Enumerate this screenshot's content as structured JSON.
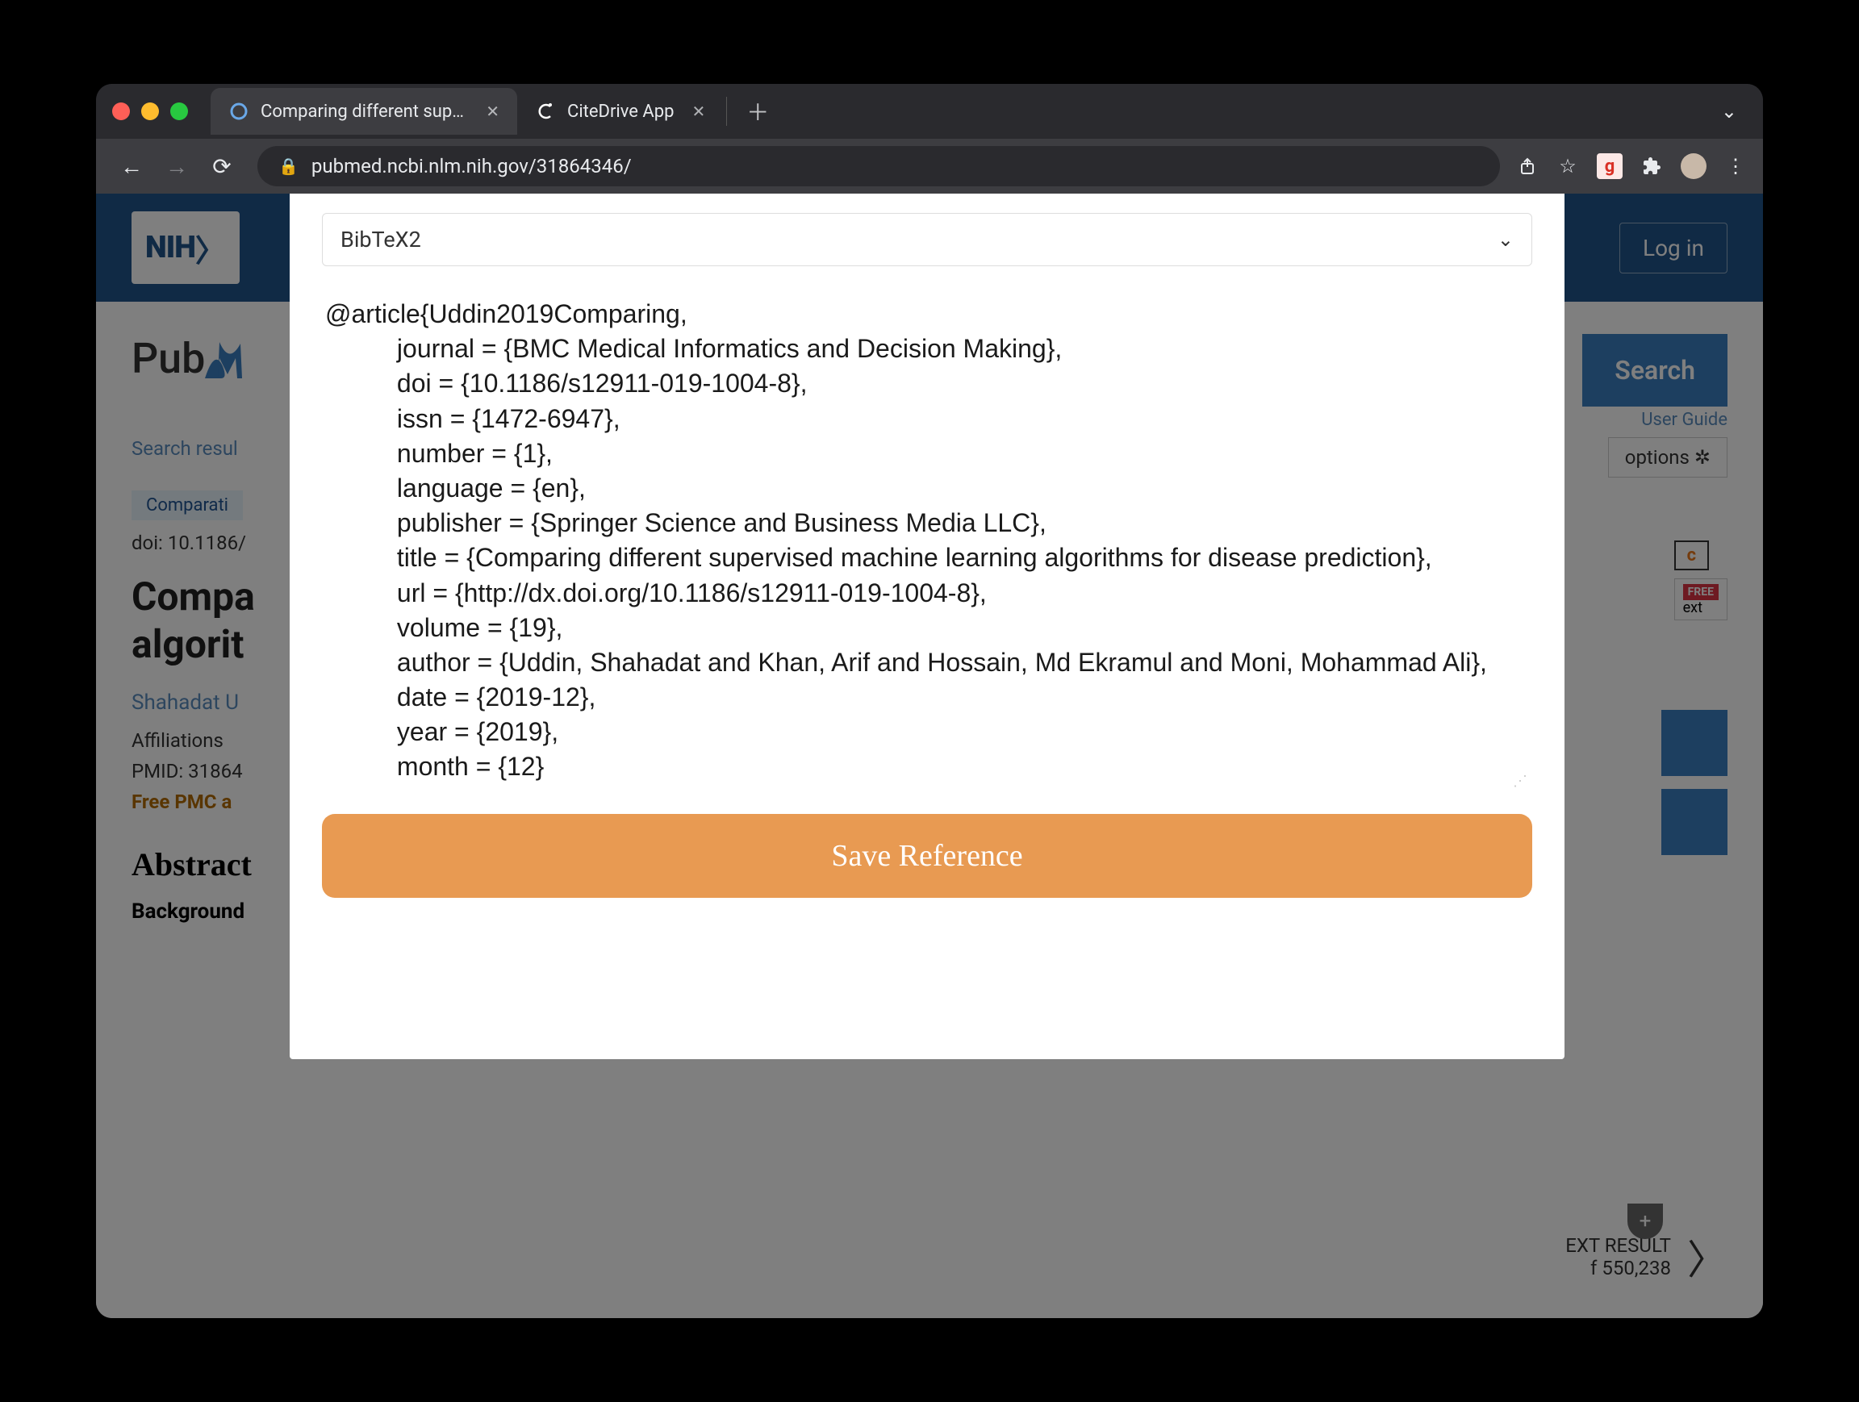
{
  "tabs": {
    "tab1": {
      "title": "Comparing different supervise"
    },
    "tab2": {
      "title": "CiteDrive App"
    }
  },
  "url_text": "pubmed.ncbi.nlm.nih.gov/31864346/",
  "nih": {
    "logo": "NIH",
    "login": "Log in"
  },
  "pubmed": {
    "brand_prefix": "Pub",
    "brand_m": "M",
    "search_btn": "Search",
    "user_guide": "User Guide"
  },
  "results": {
    "search_result": "Search resul",
    "display_options": "options",
    "gear_suffix": " ✲"
  },
  "article": {
    "comparative": "Comparati",
    "doi": "doi: 10.1186/",
    "title_visible": "Compa\nalgorit",
    "authors": "Shahadat U",
    "affiliations": "Affiliations  ",
    "pmid": "PMID: 31864",
    "free_pmc": "Free PMC a",
    "abstract": "Abstract",
    "background": "Background"
  },
  "fulltext": {
    "bmc_prefix": "c",
    "free_tag": "FREE",
    "ext_label": "ext"
  },
  "next_result": {
    "line1": "EXT RESULT",
    "line2": "f 550,238"
  },
  "modal": {
    "select_label": "BibTeX2",
    "bibtex": "@article{Uddin2019Comparing,\n          journal = {BMC Medical Informatics and Decision Making},\n          doi = {10.1186/s12911-019-1004-8},\n          issn = {1472-6947},\n          number = {1},\n          language = {en},\n          publisher = {Springer Science and Business Media LLC},\n          title = {Comparing different supervised machine learning algorithms for disease prediction},\n          url = {http://dx.doi.org/10.1186/s12911-019-1004-8},\n          volume = {19},\n          author = {Uddin, Shahadat and Khan, Arif and Hossain, Md Ekramul and Moni, Mohammad Ali},\n          date = {2019-12},\n          year = {2019},\n          month = {12}",
    "save_btn": "Save Reference"
  },
  "ext_icons": {
    "g": "g"
  }
}
